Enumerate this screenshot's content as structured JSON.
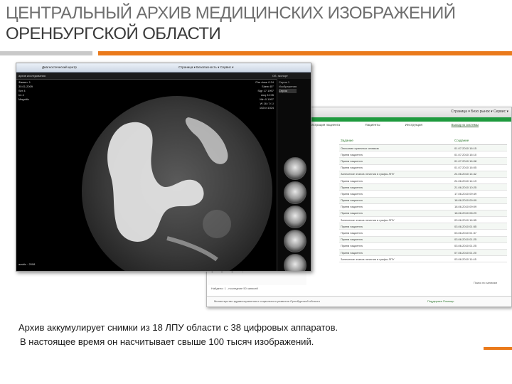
{
  "slide": {
    "title_line1": "ЦЕНТРАЛЬНЫЙ АРХИВ МЕДИЦИНСКИХ ИЗОБРАЖЕНИЙ",
    "title_line2": "ОРЕНБУРГСКОЙ ОБЛАСТИ",
    "caption_line1": "Архив аккумулирует снимки из 18 ЛПУ области с 38 цифровых аппаратов.",
    "caption_line2": "В настоящее время он насчитывает свыше 100 тысяч изображений.",
    "colors": {
      "accent": "#ea7a1b",
      "rule_gray": "#c9c9c9",
      "title": "#3a3a3a"
    }
  },
  "viewer": {
    "browser_tab": "Диагностический центр",
    "browser_tools": "Страница ▾  Безопасность ▾  Сервис ▾",
    "app_left": "архив  исследования",
    "app_right": "Об. экспорт",
    "overlay_left": [
      "Фамил. 1",
      "30.01.2009",
      "Ser 4",
      "Im 4",
      "Magnitic"
    ],
    "overlay_right": [
      "Fire dose 0.24",
      "Skew 45°",
      "Sigr 17 1997",
      "Acq 24 05",
      "Min 0 1997",
      "W 16 / 0 1/",
      "1024×1024"
    ],
    "overlay_bottom": "arabic · 2008",
    "tree": [
      "Серия 1",
      "Изображения",
      "Серия"
    ]
  },
  "ris": {
    "browser_tools": "Страница ▾  Безо рынок ▾  Сервис ▾",
    "nav": [
      "Регистрация пациента",
      "Пациенты",
      "Инструкция"
    ],
    "logout": "Выход из системы",
    "columns": [
      "Задание",
      "Создание"
    ],
    "rows": [
      [
        "Описание принятых снимков",
        "01.07.2010 16:15"
      ],
      [
        "Прием пациента",
        "01.07.2010 16:10"
      ],
      [
        "Прием пациента",
        "01.07.2010 16:08"
      ],
      [
        "Прием пациента",
        "01.07.2010 16:05"
      ],
      [
        "Занесение этапов лечения в графы ЛПУ",
        "24.06.2010 14:42"
      ],
      [
        "Прием пациента",
        "24.06.2010 14:19"
      ],
      [
        "Прием пациента",
        "21.06.2010 10:25"
      ],
      [
        "Прием пациента",
        "17.06.2010 09:49"
      ],
      [
        "Прием пациента",
        "18.06.2010 09:09"
      ],
      [
        "Прием пациента",
        "18.06.2010 09:09"
      ],
      [
        "Прием пациента",
        "18.06.2010 08:29"
      ],
      [
        "Занесение этапов лечения в графы ЛПУ",
        "03.06.2010 16:55"
      ],
      [
        "Прием пациента",
        "03.06.2010 01:55"
      ],
      [
        "Прием пациента",
        "03.06.2010 01:37"
      ],
      [
        "Прием пациента",
        "03.06.2010 01:25"
      ],
      [
        "Прием пациента",
        "03.06.2010 01:25"
      ],
      [
        "Прием пациента",
        "07.06.2010 01:20"
      ],
      [
        "Занесение этапов лечения в графы ЛПУ",
        "03.06.2010 11:45"
      ]
    ],
    "pages": [
      "1",
      "2",
      "3",
      "4"
    ],
    "selection_note": "Найдено: 1 - последние 50 записей",
    "search_label": "Поиск по записям",
    "footer_left": "Министерство здравоохранения и социального развития Оренбургской области",
    "footer_right": "Поддержка Помощь"
  }
}
